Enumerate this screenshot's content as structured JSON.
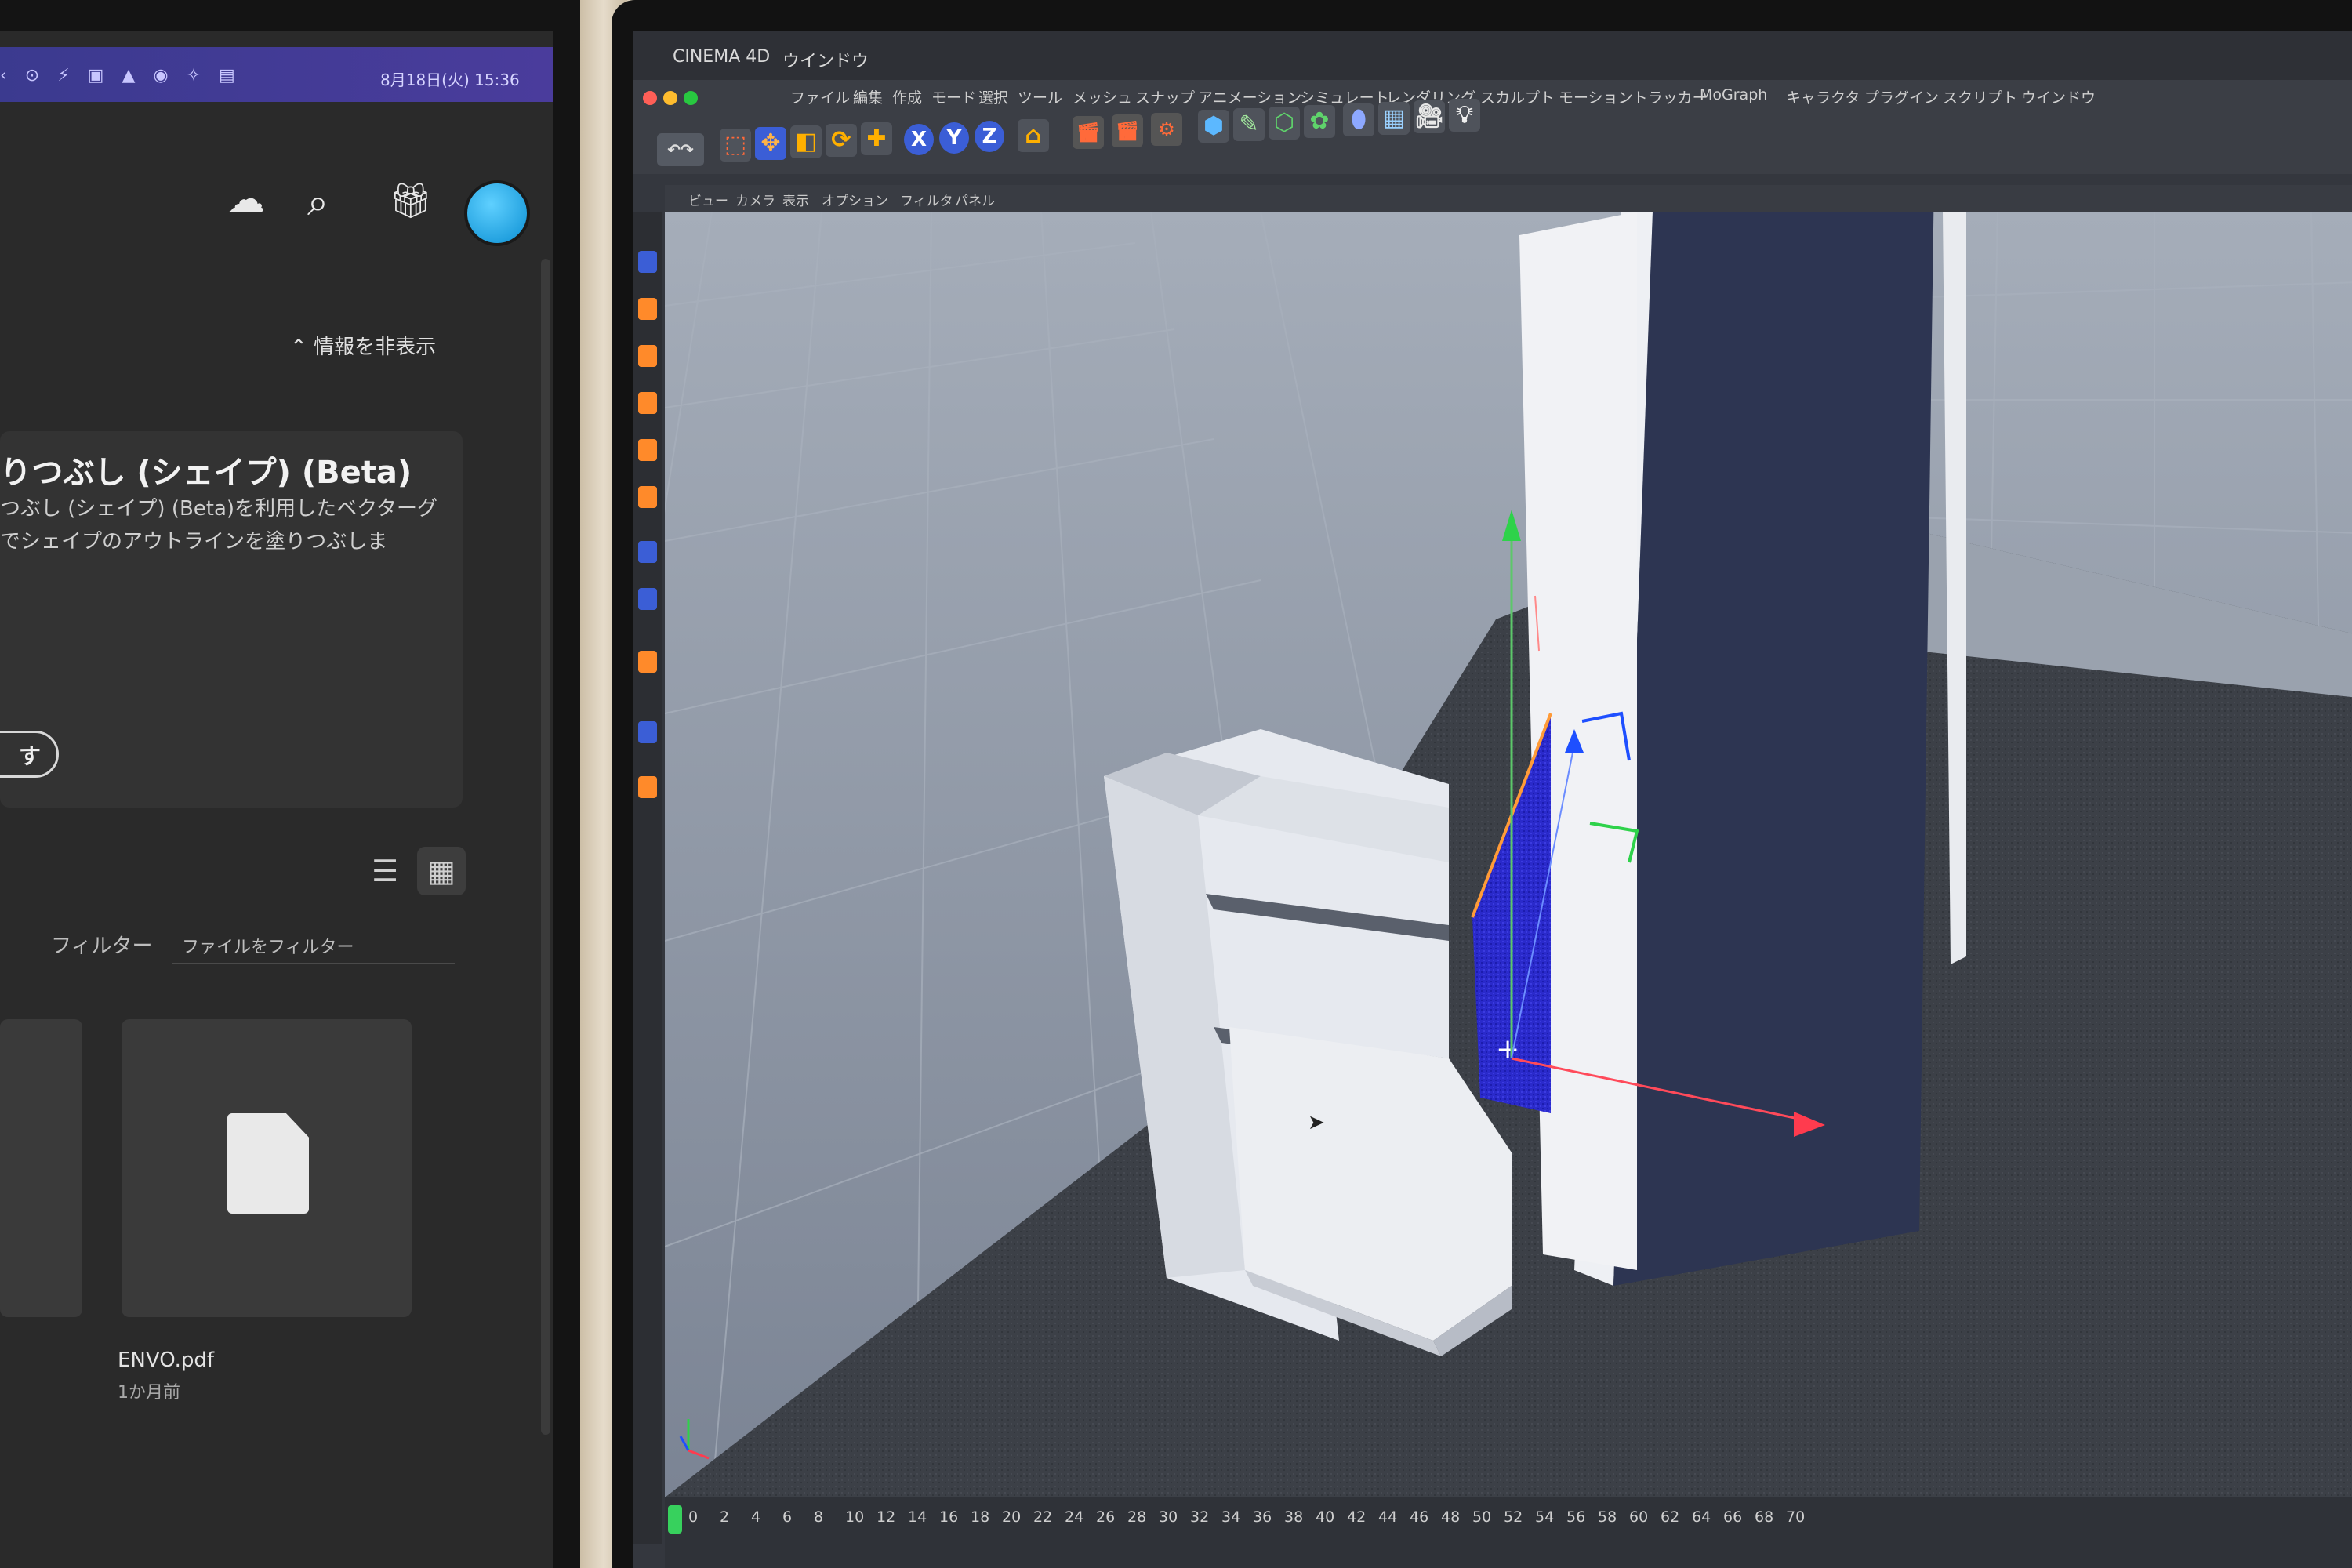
{
  "left_app": {
    "menubar": {
      "status_icons": "‹ ⊙ ⚡ ▣ ▲ ◉ ✧ ▤",
      "clock": "8月18日(火) 15:36"
    },
    "header_icons": [
      "cloud-icon",
      "search-icon",
      "gift-icon",
      "avatar"
    ],
    "hide_info_label": "情報を非表示",
    "feature": {
      "title": "りつぶし (シェイプ) (Beta)",
      "description_lines": [
        "つぶし (シェイプ) (Beta)を利用したベクターグ",
        "でシェイプのアウトラインを塗りつぶしま"
      ],
      "cta_label": "す"
    },
    "view_toggles": [
      "list-view-icon",
      "grid-view-icon"
    ],
    "filter_tabs": [
      "フィルター",
      "ファイルをフィルター"
    ],
    "file": {
      "name": "ENVO.pdf",
      "date": "1か月前"
    }
  },
  "right_app": {
    "mac_menu": [
      "CINEMA 4D",
      "ウインドウ"
    ],
    "app_menu": [
      "ファイル",
      "編集",
      "作成",
      "モード",
      "選択",
      "ツール",
      "メッシュ",
      "スナップ",
      "アニメーション",
      "シミュレート",
      "レンダリング",
      "スカルプト",
      "モーショントラッカー",
      "MoGraph",
      "キャラクタ",
      "プラグイン",
      "スクリプト",
      "ウインドウ"
    ],
    "axis_buttons": [
      "X",
      "Y",
      "Z"
    ],
    "view_menu": [
      "ビュー",
      "カメラ",
      "表示",
      "オプション",
      "フィルタ",
      "パネル"
    ],
    "timeline_ticks": [
      "0",
      "2",
      "4",
      "6",
      "8",
      "10",
      "12",
      "14",
      "16",
      "18",
      "20",
      "22",
      "24",
      "26",
      "28",
      "30",
      "32",
      "34",
      "36",
      "38",
      "40",
      "42",
      "44",
      "46",
      "48",
      "50",
      "52",
      "54",
      "56",
      "58",
      "60",
      "62",
      "64",
      "66",
      "68",
      "70"
    ],
    "colors": {
      "viewport_bg": "#8f99a8",
      "floor": "#3a3e45",
      "selected_face": "#2222c8",
      "axis_x": "#ff3b4e",
      "axis_y": "#2ed24a",
      "axis_z": "#1e4fff"
    }
  }
}
